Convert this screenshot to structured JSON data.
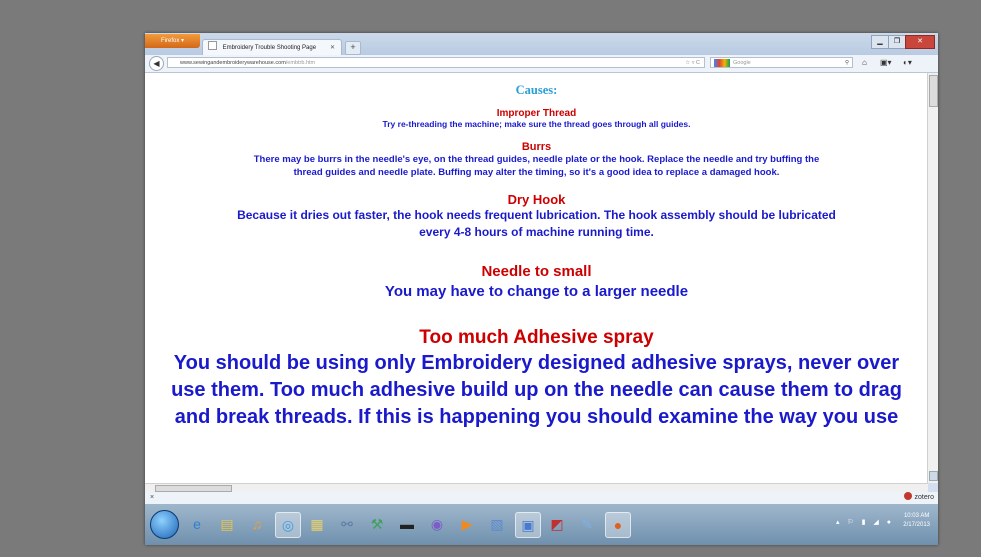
{
  "browser": {
    "app_button": "Firefox",
    "tab_title": "Embroidery Trouble Shooting Page",
    "url_domain": "www.sewingandembroiderywarehouse.com",
    "url_path": "/embtrb.htm",
    "search_placeholder": "Google"
  },
  "page": {
    "heading": "Causes:",
    "sections": [
      {
        "title": "Improper Thread",
        "lines": [
          "Try re-threading the machine; make sure the thread goes through all guides."
        ]
      },
      {
        "title": "Burrs",
        "lines": [
          "There may be burrs in the needle's eye, on the thread guides, needle plate or the hook. Replace the needle and try buffing the",
          "thread guides and needle plate. Buffing may alter the timing, so it's a good idea to replace a damaged hook."
        ]
      },
      {
        "title": "Dry Hook",
        "lines": [
          "Because it dries out faster, the hook needs frequent lubrication. The hook assembly should be lubricated",
          "every 4-8 hours of machine running time."
        ]
      },
      {
        "title": "Needle to small",
        "lines": [
          "You may have to change to a larger needle"
        ]
      },
      {
        "title": "Too much Adhesive spray",
        "lines": [
          "You should be using only Embroidery designed adhesive sprays, never over",
          "use them. Too much adhesive build up on the needle can cause them to drag",
          "and break threads. If this is happening you should examine the way you use"
        ]
      }
    ]
  },
  "statusbar": {
    "close": "×",
    "addon": "zotero"
  },
  "taskbar": {
    "icons": [
      "ie-icon",
      "explorer-icon",
      "media-icon",
      "firefox-alt-icon",
      "folder-icon",
      "network-icon",
      "tool-icon",
      "terminal-icon",
      "globe-icon",
      "play-icon",
      "scan-icon",
      "window-icon",
      "office-icon",
      "paint-icon",
      "firefox-icon"
    ],
    "time": "10:03 AM",
    "date": "2/17/2013"
  }
}
